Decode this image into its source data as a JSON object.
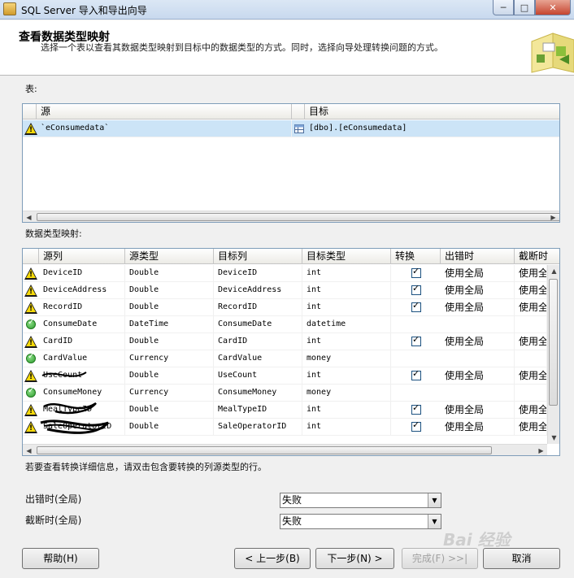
{
  "window": {
    "title": "SQL Server 导入和导出向导",
    "minimize": "─",
    "maximize": "□",
    "close": "✕"
  },
  "header": {
    "title": "查看数据类型映射",
    "description": "选择一个表以查看其数据类型映射到目标中的数据类型的方式。同时，选择向导处理转换问题的方式。"
  },
  "tables_section": {
    "label": "表:",
    "columns": [
      "源",
      "目标"
    ],
    "rows": [
      {
        "status": "warning",
        "source": "`eConsumedata`",
        "target": "[dbo].[eConsumedata]"
      }
    ]
  },
  "mapping_section": {
    "label": "数据类型映射:",
    "columns": [
      "源列",
      "源类型",
      "目标列",
      "目标类型",
      "转换",
      "出错时",
      "截断时"
    ],
    "rows": [
      {
        "status": "warning",
        "src": "DeviceID",
        "src_type": "Double",
        "dst": "DeviceID",
        "dst_type": "int",
        "convert": true,
        "on_error": "使用全局",
        "on_trunc": "使用全"
      },
      {
        "status": "warning",
        "src": "DeviceAddress",
        "src_type": "Double",
        "dst": "DeviceAddress",
        "dst_type": "int",
        "convert": true,
        "on_error": "使用全局",
        "on_trunc": "使用全"
      },
      {
        "status": "warning",
        "src": "RecordID",
        "src_type": "Double",
        "dst": "RecordID",
        "dst_type": "int",
        "convert": true,
        "on_error": "使用全局",
        "on_trunc": "使用全"
      },
      {
        "status": "ok",
        "src": "ConsumeDate",
        "src_type": "DateTime",
        "dst": "ConsumeDate",
        "dst_type": "datetime",
        "convert": false,
        "on_error": "",
        "on_trunc": ""
      },
      {
        "status": "warning",
        "src": "CardID",
        "src_type": "Double",
        "dst": "CardID",
        "dst_type": "int",
        "convert": true,
        "on_error": "使用全局",
        "on_trunc": "使用全"
      },
      {
        "status": "ok",
        "src": "CardValue",
        "src_type": "Currency",
        "dst": "CardValue",
        "dst_type": "money",
        "convert": false,
        "on_error": "",
        "on_trunc": ""
      },
      {
        "status": "warning",
        "src": "UseCount",
        "src_type": "Double",
        "dst": "UseCount",
        "dst_type": "int",
        "convert": true,
        "on_error": "使用全局",
        "on_trunc": "使用全"
      },
      {
        "status": "ok",
        "src": "ConsumeMoney",
        "src_type": "Currency",
        "dst": "ConsumeMoney",
        "dst_type": "money",
        "convert": false,
        "on_error": "",
        "on_trunc": ""
      },
      {
        "status": "warning",
        "src": "MealTypeID",
        "src_type": "Double",
        "dst": "MealTypeID",
        "dst_type": "int",
        "convert": true,
        "on_error": "使用全局",
        "on_trunc": "使用全"
      },
      {
        "status": "warning",
        "src": "SaleOperatorID",
        "src_type": "Double",
        "dst": "SaleOperatorID",
        "dst_type": "int",
        "convert": true,
        "on_error": "使用全局",
        "on_trunc": "使用全"
      }
    ],
    "hint": "若要查看转换详细信息，请双击包含要转换的列源类型的行。"
  },
  "options": {
    "on_error_label": "出错时(全局)",
    "on_error_value": "失败",
    "on_trunc_label": "截断时(全局)",
    "on_trunc_value": "失败"
  },
  "buttons": {
    "help": "帮助(H)",
    "back": "< 上一步(B)",
    "next": "下一步(N) >",
    "finish": "完成(F) >>|",
    "cancel": "取消"
  },
  "watermark": "Bai 经验"
}
